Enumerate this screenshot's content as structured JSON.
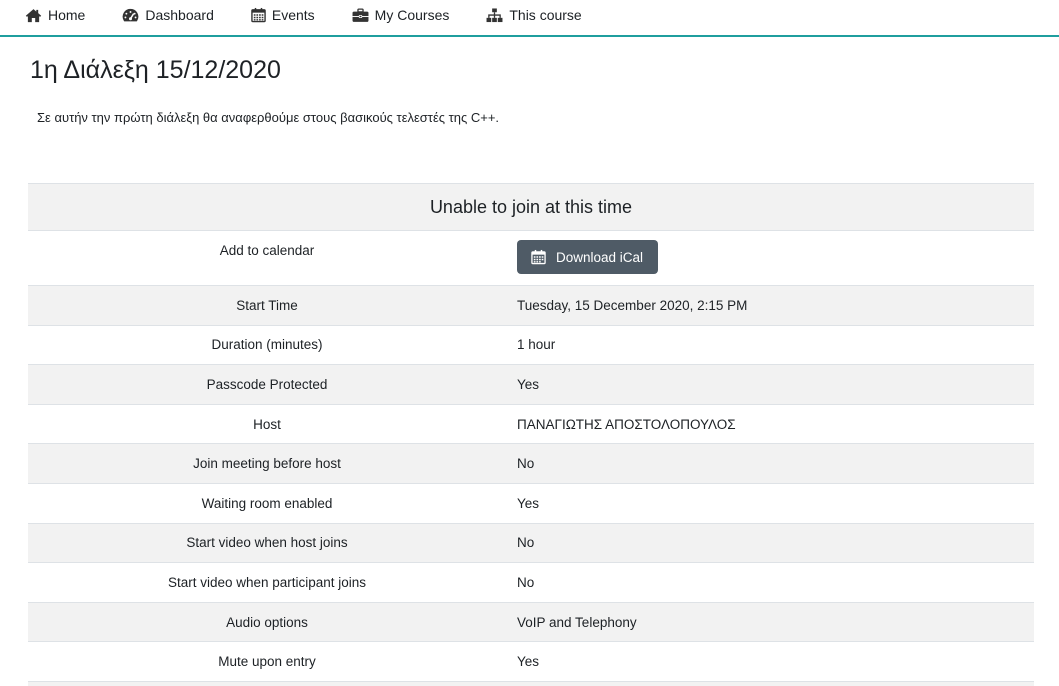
{
  "nav": {
    "items": [
      {
        "label": "Home",
        "icon": "home-icon"
      },
      {
        "label": "Dashboard",
        "icon": "dashboard-icon"
      },
      {
        "label": "Events",
        "icon": "calendar-icon"
      },
      {
        "label": "My Courses",
        "icon": "briefcase-icon"
      },
      {
        "label": "This course",
        "icon": "sitemap-icon"
      }
    ]
  },
  "page": {
    "title": "1η Διάλεξη 15/12/2020",
    "intro": "Σε αυτήν την πρώτη διάλεξη θα αναφερθούμε στους βασικούς τελεστές της C++."
  },
  "meeting": {
    "status": "Unable to join at this time",
    "calendar": {
      "label": "Add to calendar",
      "button": "Download iCal",
      "icon": "calendar-icon"
    },
    "rows": [
      {
        "label": "Start Time",
        "value": "Tuesday, 15 December 2020, 2:15 PM"
      },
      {
        "label": "Duration (minutes)",
        "value": "1 hour"
      },
      {
        "label": "Passcode Protected",
        "value": "Yes"
      },
      {
        "label": "Host",
        "value": "ΠΑΝΑΓΙΩΤΗΣ ΑΠΟΣΤΟΛΟΠΟΥΛΟΣ"
      },
      {
        "label": "Join meeting before host",
        "value": "No"
      },
      {
        "label": "Waiting room enabled",
        "value": "Yes"
      },
      {
        "label": "Start video when host joins",
        "value": "No"
      },
      {
        "label": "Start video when participant joins",
        "value": "No"
      },
      {
        "label": "Audio options",
        "value": "VoIP and Telephony"
      },
      {
        "label": "Mute upon entry",
        "value": "Yes"
      }
    ]
  },
  "colors": {
    "accent": "#1f9e9e",
    "button": "#4f5b66",
    "stripe": "#f2f2f2",
    "text": "#1d2125"
  }
}
